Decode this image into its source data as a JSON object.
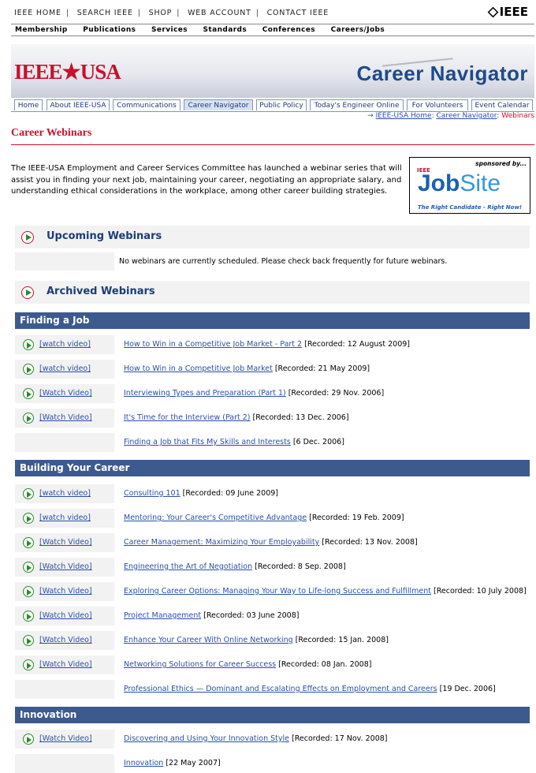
{
  "topbar": {
    "links": [
      "IEEE HOME",
      "SEARCH IEEE",
      "SHOP",
      "WEB ACCOUNT",
      "CONTACT IEEE"
    ],
    "logo": "IEEE"
  },
  "mainnav": [
    "Membership",
    "Publications",
    "Services",
    "Standards",
    "Conferences",
    "Careers/Jobs"
  ],
  "banner": {
    "org": "IEEE★USA",
    "title": "Career Navigator"
  },
  "tabs": [
    {
      "label": "Home",
      "active": false
    },
    {
      "label": "About IEEE-USA",
      "active": false
    },
    {
      "label": "Communications",
      "active": false
    },
    {
      "label": "Career Navigator",
      "active": true
    },
    {
      "label": "Public Policy",
      "active": false
    },
    {
      "label": "Today's Engineer Online",
      "active": false
    },
    {
      "label": "For Volunteers",
      "active": false
    },
    {
      "label": "Event Calendar",
      "active": false
    }
  ],
  "breadcrumb": {
    "arrow": "→",
    "home": "IEEE-USA Home",
    "sep": ":",
    "section": "Career Navigator",
    "current": "Webinars"
  },
  "page": {
    "title": "Career Webinars",
    "intro": "The IEEE-USA Employment and Career Services Committee has launched a webinar series that will assist you in finding your next job, maintaining your career, negotiating an appropriate salary, and understanding ethical considerations in the workplace, among other career building strategies."
  },
  "sponsor": {
    "label": "sponsored by...",
    "ieee": "IEEE",
    "job": "Job",
    "site": "Site",
    "tagline": "The Right Candidate - Right Now!"
  },
  "upcoming": {
    "title": "Upcoming Webinars",
    "message": "No webinars are currently scheduled. Please check back frequently for future webinars."
  },
  "archived": {
    "title": "Archived Webinars"
  },
  "categories": [
    {
      "name": "Finding a Job",
      "items": [
        {
          "video": "[watch video]",
          "title": "How to Win in a Competitive Job Market - Part 2",
          "meta": " [Recorded: 12 August 2009]"
        },
        {
          "video": "[watch video]",
          "title": "How to Win in a Competitive Job Market",
          "meta": " [Recorded: 21 May 2009]"
        },
        {
          "video": "[Watch Video]",
          "title": "Interviewing Types and Preparation (Part 1)",
          "meta": " [Recorded: 29 Nov. 2006]"
        },
        {
          "video": "[Watch Video]",
          "title": "It's Time for the Interview (Part 2)",
          "meta": " [Recorded: 13 Dec. 2006]"
        },
        {
          "video": "",
          "title": "Finding a Job that Fits My Skills and Interests",
          "meta": " [6 Dec. 2006]"
        }
      ]
    },
    {
      "name": "Building Your Career",
      "items": [
        {
          "video": "[watch video]",
          "title": "Consulting 101",
          "meta": " [Recorded: 09 June 2009]"
        },
        {
          "video": "[watch video]",
          "title": "Mentoring: Your Career's Competitive Advantage",
          "meta": " [Recorded: 19 Feb. 2009]"
        },
        {
          "video": "[Watch Video]",
          "title": "Career Management: Maximizing Your Employability",
          "meta": " [Recorded: 13 Nov. 2008]"
        },
        {
          "video": "[Watch Video]",
          "title": "Engineering the Art of Negotiation",
          "meta": " [Recorded: 8 Sep. 2008]"
        },
        {
          "video": "[Watch Video]",
          "title": "Exploring Career Options: Managing Your Way to Life-long Success and Fulfillment",
          "meta": " [Recorded: 10 July 2008]"
        },
        {
          "video": "[Watch Video]",
          "title": "Project Management",
          "meta": " [Recorded: 03 June 2008]"
        },
        {
          "video": "[Watch Video]",
          "title": "Enhance Your Career With Online Networking",
          "meta": " [Recorded: 15 Jan. 2008]"
        },
        {
          "video": "[Watch Video]",
          "title": "Networking Solutions for Career Success",
          "meta": " [Recorded: 08 Jan. 2008]"
        },
        {
          "video": "",
          "title": "Professional Ethics — Dominant and Escalating Effects on Employment and Careers",
          "meta": " [19 Dec. 2006]"
        }
      ]
    },
    {
      "name": "Innovation",
      "items": [
        {
          "video": "[Watch Video]",
          "title": "Discovering and Using Your Innovation Style",
          "meta": " [Recorded: 17 Nov. 2008]"
        },
        {
          "video": "",
          "title": "Innovation",
          "meta": " [22 May 2007]"
        }
      ]
    }
  ]
}
